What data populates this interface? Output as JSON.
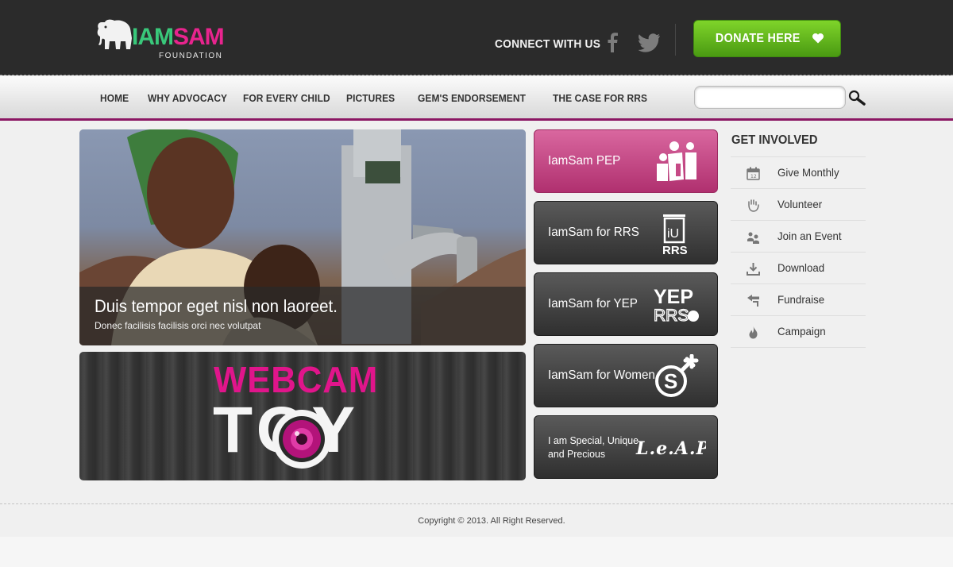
{
  "header": {
    "logo": {
      "brand_part1": "IAM",
      "brand_part2": "SAM",
      "subtitle": "FOUNDATION"
    },
    "connect_label": "CONNECT WITH US",
    "social": [
      {
        "name": "facebook-icon"
      },
      {
        "name": "twitter-icon"
      }
    ],
    "donate_label": "DONATE HERE",
    "donate_color": "#5cb31a"
  },
  "nav": {
    "items": [
      {
        "label": "HOME"
      },
      {
        "label": "WHY ADVOCACY"
      },
      {
        "label": "FOR EVERY CHILD"
      },
      {
        "label": "PICTURES"
      },
      {
        "label": "GEM'S ENDORSEMENT"
      },
      {
        "label": "THE CASE FOR RRS"
      }
    ],
    "search": {
      "placeholder": "",
      "value": ""
    },
    "accent_color": "#8b1763"
  },
  "hero": {
    "title": "Duis tempor eget nisl non laoreet.",
    "subtitle": "Donec facilisis facilisis orci nec volutpat"
  },
  "webcam": {
    "line1": "WEBCAM",
    "line2": "TOY"
  },
  "tiles": [
    {
      "label": "IamSam PEP",
      "icon": "family-icon"
    },
    {
      "label": "IamSam for RRS",
      "icon": "rrs-icon"
    },
    {
      "label": "IamSam for YEP",
      "icon": "yep-rrs-icon"
    },
    {
      "label": "IamSam for Women",
      "icon": "women-symbol-icon"
    },
    {
      "label": "I am Special, Unique and Precious",
      "icon": "leaps-icon",
      "logo_text": "L.e.A.P.S."
    }
  ],
  "sidebar": {
    "title": "GET INVOLVED",
    "items": [
      {
        "label": "Give Monthly",
        "icon": "calendar-icon"
      },
      {
        "label": "Volunteer",
        "icon": "hand-icon"
      },
      {
        "label": "Join an Event",
        "icon": "people-icon"
      },
      {
        "label": "Download",
        "icon": "download-icon"
      },
      {
        "label": "Fundraise",
        "icon": "arrow-icon"
      },
      {
        "label": "Campaign",
        "icon": "flame-icon"
      }
    ]
  },
  "footer": {
    "copyright": "Copyright © 2013. All Right Reserved."
  }
}
